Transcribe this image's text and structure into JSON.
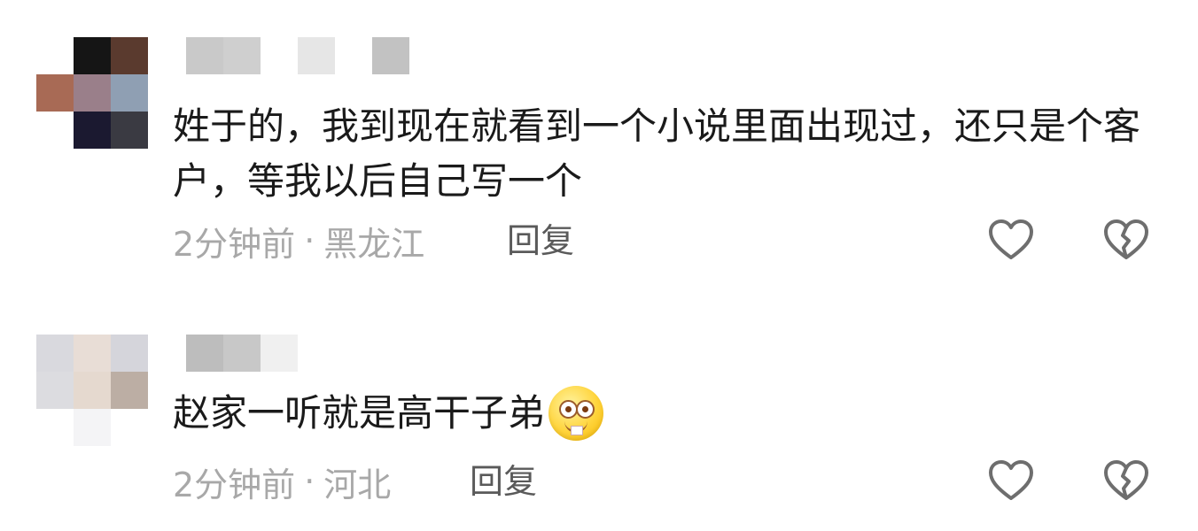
{
  "comments": [
    {
      "avatar_colors": [
        "#ffffff",
        "#151515",
        "#5a3a2e",
        "#a86a55",
        "#9a7f8a",
        "#8f9fb3",
        "#ffffff",
        "#1b1930",
        "#3a3a42"
      ],
      "username_colors": [
        "#c9c9c9",
        "#cfcfcf",
        "#ffffff",
        "#e6e6e6",
        "#ffffff",
        "#c2c2c2"
      ],
      "text": "姓于的，我到现在就看到一个小说里面出现过，还只是个客户，等我以后自己写一个",
      "time": "2分钟前",
      "separator": "·",
      "location": "黑龙江",
      "reply_label": "回复",
      "like_icon": "heart-outline-icon",
      "dislike_icon": "broken-heart-icon"
    },
    {
      "avatar_colors": [
        "#d9d9de",
        "#e8ddd6",
        "#d5d5db",
        "#dcdce0",
        "#e5d9cf",
        "#bcaea4",
        "#ffffff",
        "#f4f4f6",
        "#ffffff"
      ],
      "username_colors": [
        "#bdbdbd",
        "#c8c8c8",
        "#f0f0f0"
      ],
      "text": "赵家一听就是高干子弟",
      "emoji_icon": "silly-buck-teeth-emoji-icon",
      "time": "2分钟前",
      "separator": "·",
      "location": "河北",
      "reply_label": "回复",
      "like_icon": "heart-outline-icon",
      "dislike_icon": "broken-heart-icon"
    }
  ],
  "colors": {
    "text": "#1a1a1a",
    "meta": "#a8a8a8",
    "reply": "#5a5a5a",
    "icon": "#6e6e6e"
  }
}
